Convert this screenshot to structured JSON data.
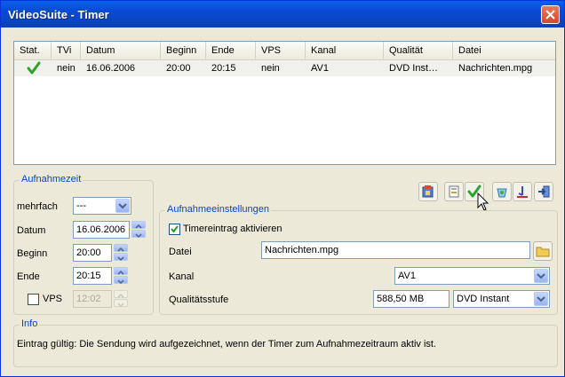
{
  "window": {
    "title": "VideoSuite - Timer"
  },
  "list": {
    "columns": [
      "Stat.",
      "TVi",
      "Datum",
      "Beginn",
      "Ende",
      "VPS",
      "Kanal",
      "Qualität",
      "Datei"
    ],
    "rows": [
      {
        "status_icon": "check-icon",
        "tvi": "nein",
        "datum": "16.06.2006",
        "beginn": "20:00",
        "ende": "20:15",
        "vps": "nein",
        "kanal": "AV1",
        "qualitaet": "DVD Inst…",
        "datei": "Nachrichten.mpg"
      }
    ]
  },
  "aufnahmezeit": {
    "title": "Aufnahmezeit",
    "mehrfach_label": "mehrfach",
    "mehrfach_value": "---",
    "datum_label": "Datum",
    "datum_value": "16.06.2006",
    "beginn_label": "Beginn",
    "beginn_value": "20:00",
    "ende_label": "Ende",
    "ende_value": "20:15",
    "vps_label": "VPS",
    "vps_checked": false,
    "vps_value": "12:02"
  },
  "toolbar": {
    "icons": [
      "new-timer-icon",
      "edit-timer-icon",
      "apply-check-icon",
      "recycle-icon",
      "tools-icon",
      "exit-icon"
    ]
  },
  "aufnahmeeinstellungen": {
    "title": "Aufnahmeeinstellungen",
    "timer_active_label": "Timereintrag aktivieren",
    "timer_active_checked": true,
    "datei_label": "Datei",
    "datei_value": "Nachrichten.mpg",
    "kanal_label": "Kanal",
    "kanal_value": "AV1",
    "qualitaet_label": "Qualitätsstufe",
    "qualitaet_size": "588,50 MB",
    "qualitaet_value": "DVD Instant"
  },
  "info": {
    "title": "Info",
    "text": "Eintrag gültig: Die Sendung wird aufgezeichnet, wenn der Timer zum Aufnahmezeitraum aktiv ist."
  },
  "colors": {
    "accent": "#0046d5",
    "titlebar": "#0a4ad4",
    "check": "#2aa52a"
  }
}
